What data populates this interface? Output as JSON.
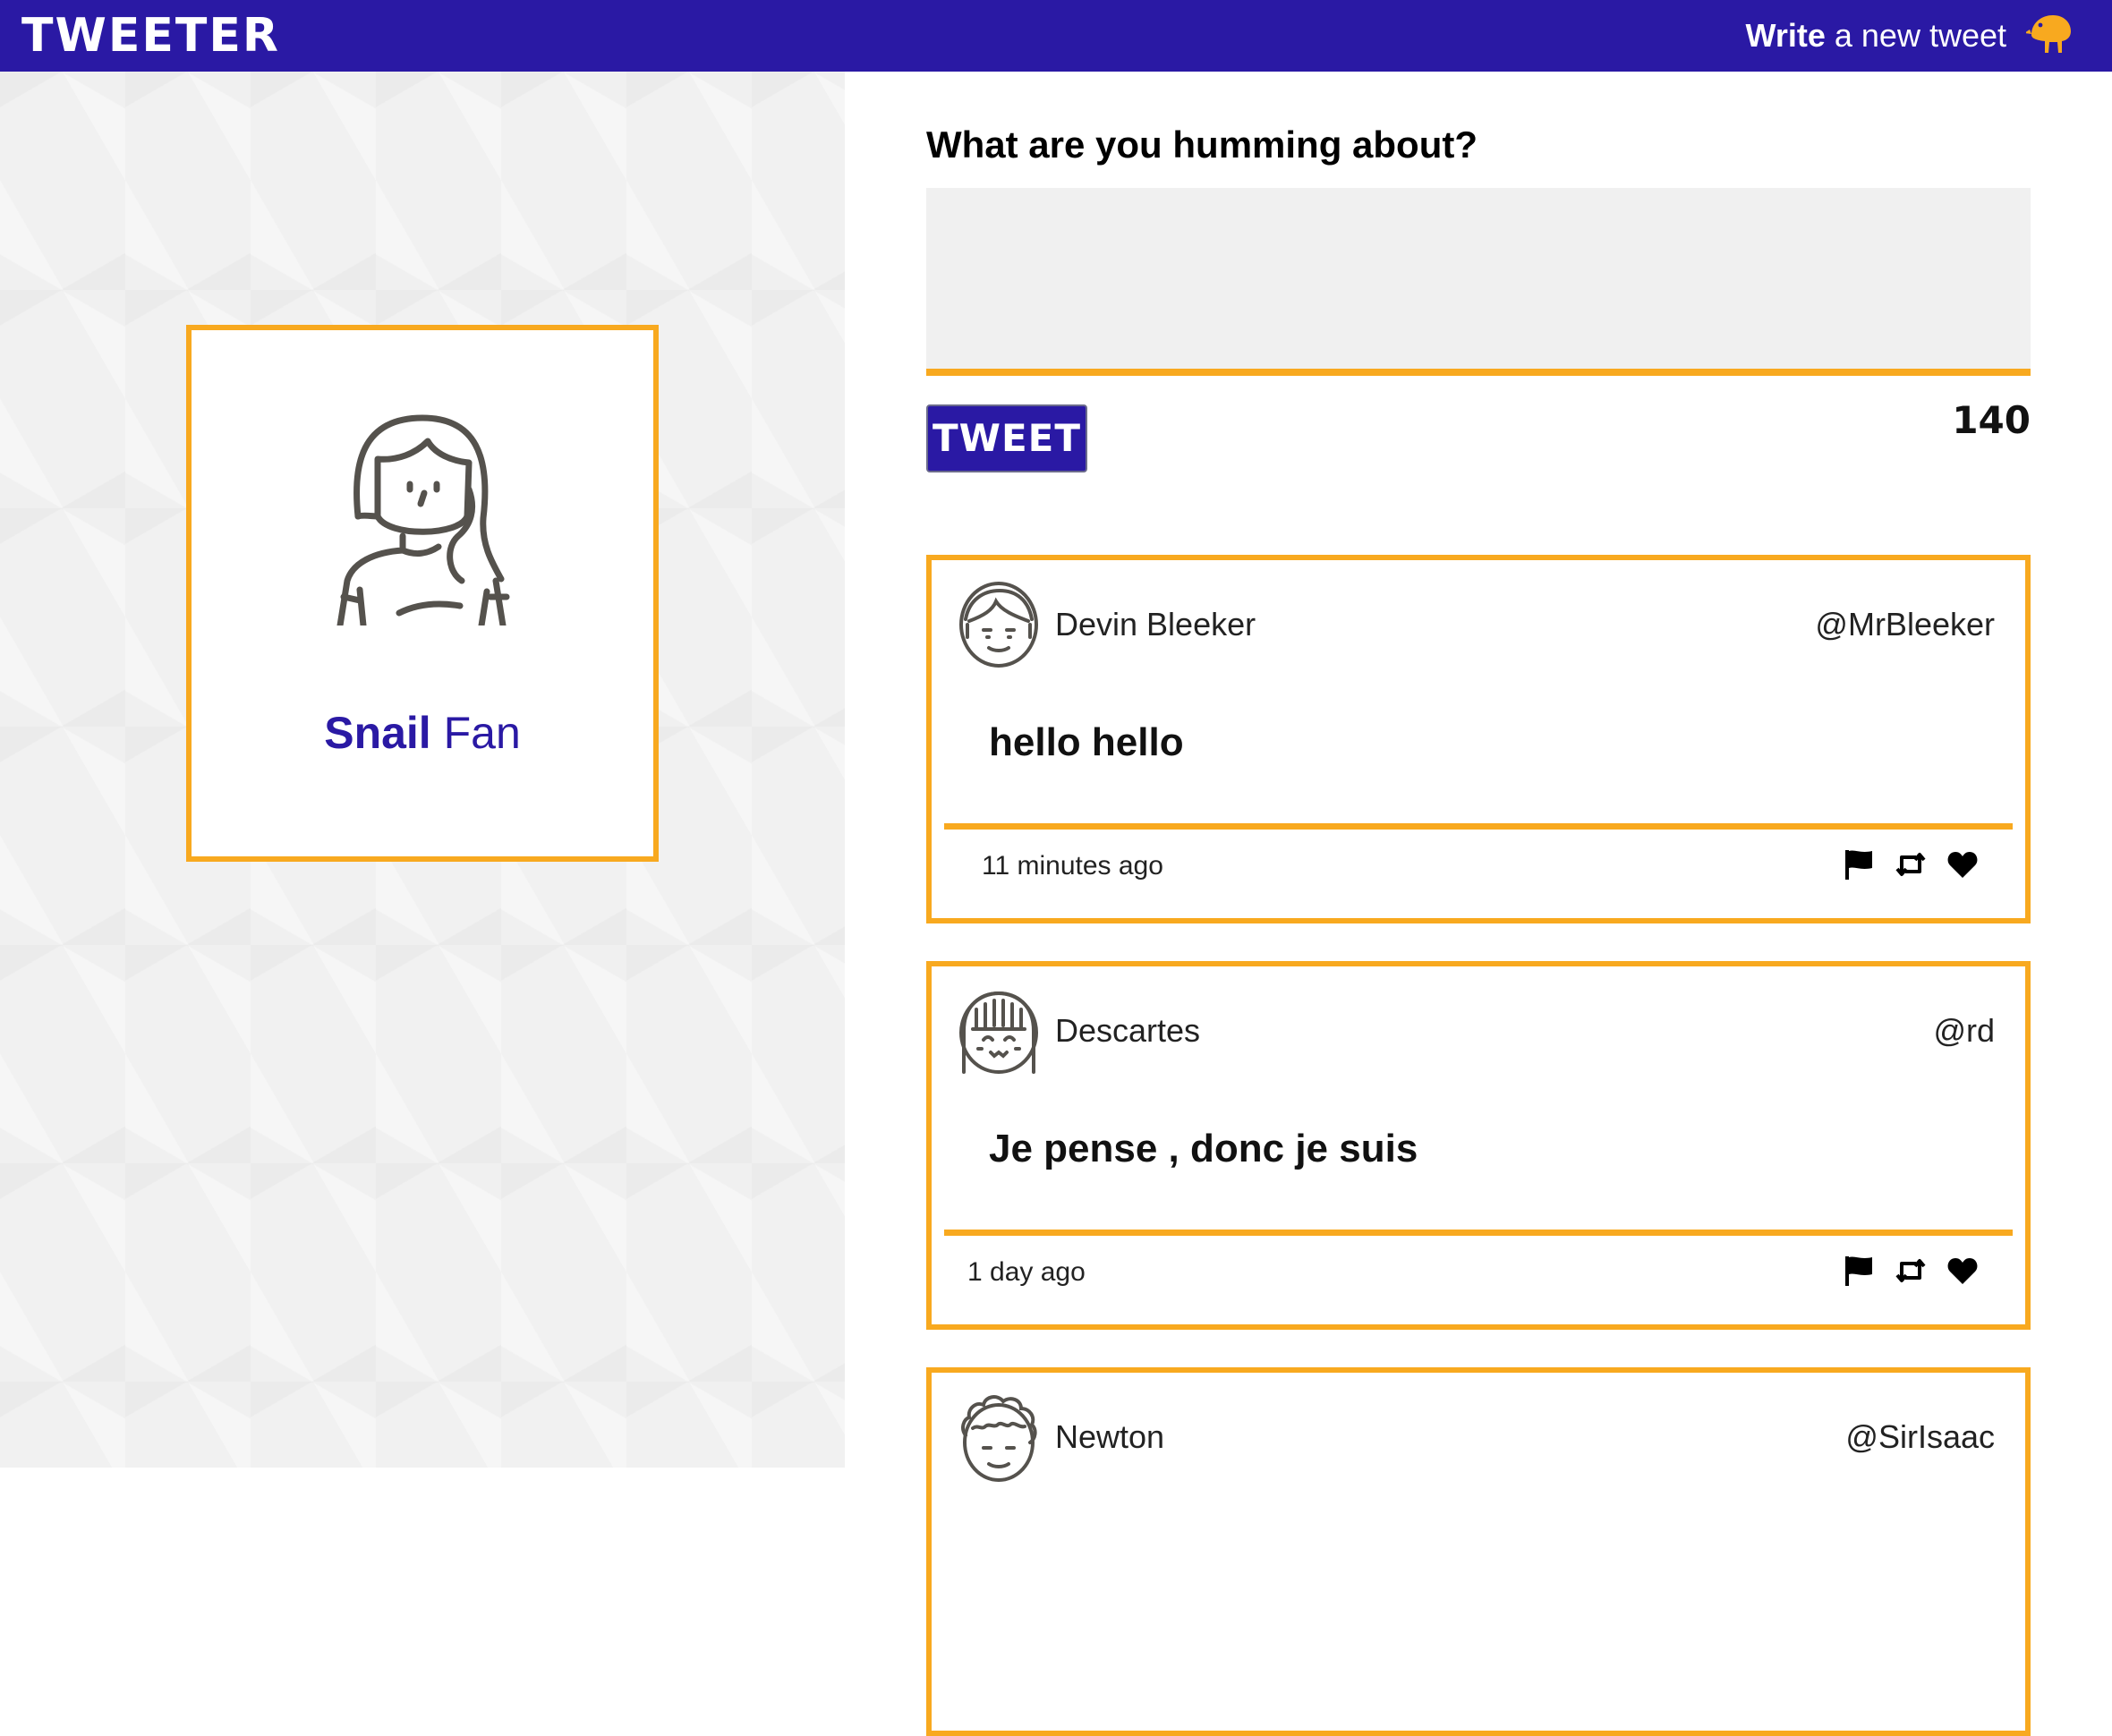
{
  "nav": {
    "brand": "TWEETER",
    "write_bold": "Write",
    "write_rest": " a new tweet",
    "bird_icon": "bird-icon"
  },
  "profile": {
    "first_name": "Snail",
    "last_name": " Fan"
  },
  "compose": {
    "heading": "What are you humming about?",
    "text": "",
    "button_label": "TWEET",
    "counter": "140"
  },
  "tweets": [
    {
      "name": "Devin Bleeker",
      "handle": "@MrBleeker",
      "text": "hello hello",
      "time": "11 minutes ago"
    },
    {
      "name": "Descartes",
      "handle": "@rd",
      "text": "Je pense , donc je suis",
      "time": "1 day ago"
    },
    {
      "name": "Newton",
      "handle": "@SirIsaac",
      "text": "",
      "time": ""
    }
  ],
  "colors": {
    "brand": "#2a19a4",
    "accent": "#f8a91f",
    "panel_bg": "#f1f1f1"
  }
}
